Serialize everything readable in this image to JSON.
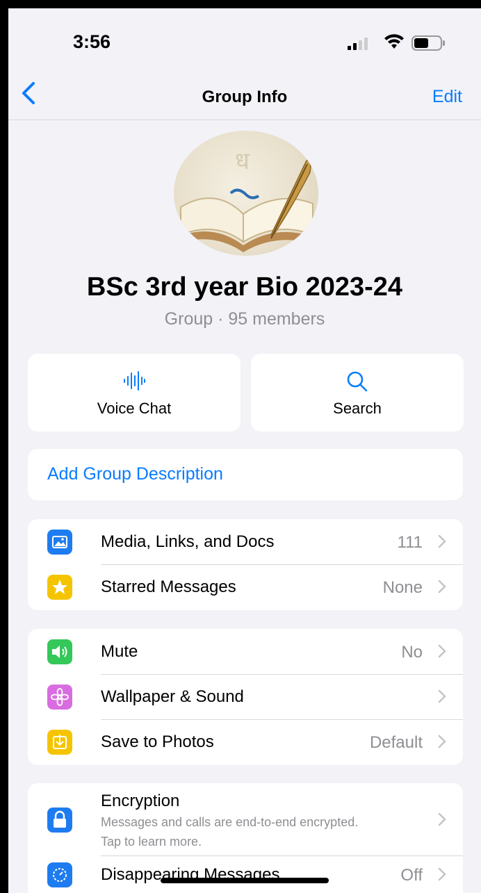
{
  "status": {
    "time": "3:56"
  },
  "nav": {
    "title": "Group Info",
    "edit": "Edit"
  },
  "group": {
    "name": "BSc 3rd year Bio 2023-24",
    "subtitle": "Group · 95 members"
  },
  "actions": [
    {
      "label": "Voice Chat",
      "icon": "waveform-icon"
    },
    {
      "label": "Search",
      "icon": "search-icon"
    }
  ],
  "description": {
    "label": "Add Group Description"
  },
  "section1": [
    {
      "title": "Media, Links, and Docs",
      "value": "111",
      "icon": "photo-icon",
      "color": "#1e7cf0"
    },
    {
      "title": "Starred Messages",
      "value": "None",
      "icon": "star-icon",
      "color": "#f5c400"
    }
  ],
  "section2": [
    {
      "title": "Mute",
      "value": "No",
      "icon": "speaker-icon",
      "color": "#34c759"
    },
    {
      "title": "Wallpaper & Sound",
      "value": "",
      "icon": "flower-icon",
      "color": "#d86de0"
    },
    {
      "title": "Save to Photos",
      "value": "Default",
      "icon": "download-icon",
      "color": "#f5c400"
    }
  ],
  "section3": [
    {
      "title": "Encryption",
      "subtitle_line1": "Messages and calls are end-to-end encrypted.",
      "subtitle_line2": "Tap to learn more.",
      "icon": "lock-icon",
      "color": "#1e7cf0"
    },
    {
      "title": "Disappearing Messages",
      "value": "Off",
      "icon": "timer-icon",
      "color": "#1e7cf0"
    }
  ]
}
